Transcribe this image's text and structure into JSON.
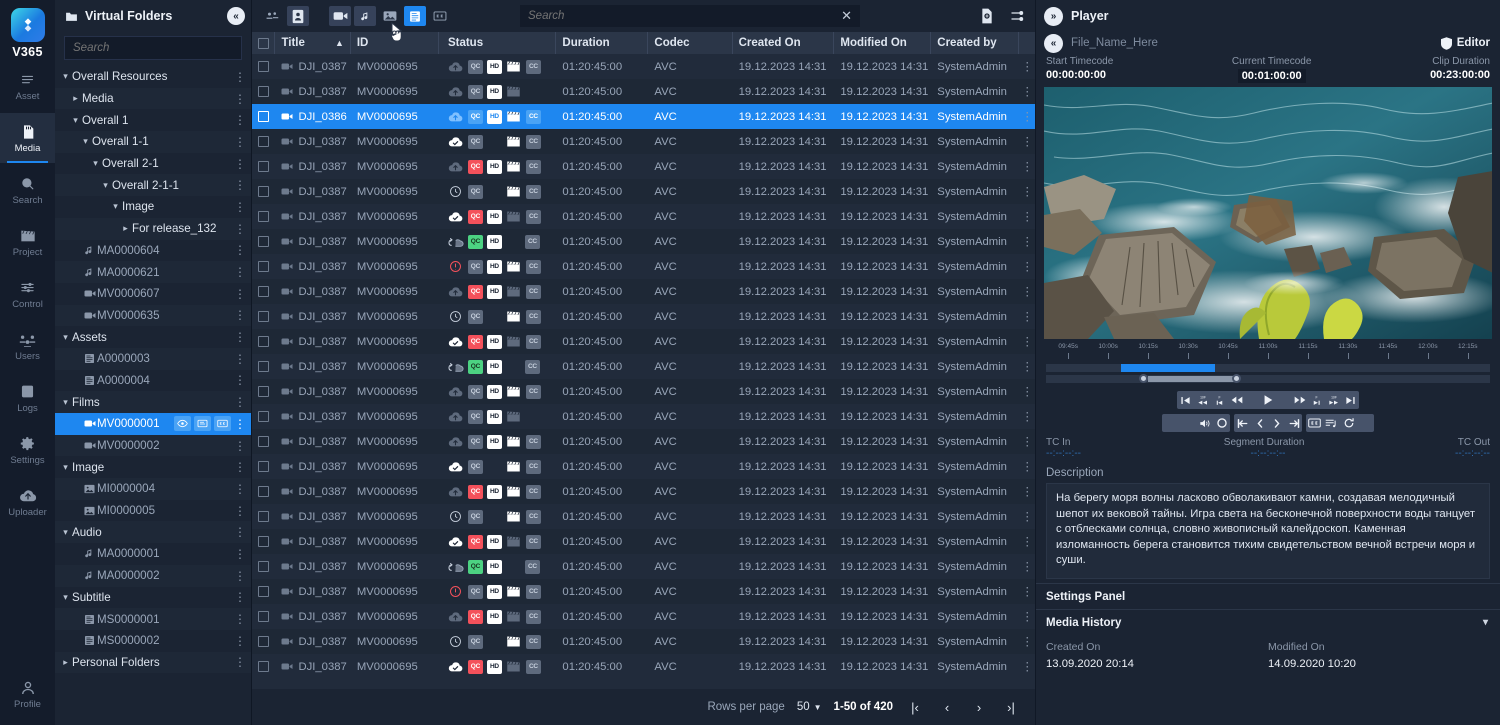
{
  "rail": {
    "brand": "V365",
    "items": [
      {
        "label": "Asset",
        "icon": "list-icon",
        "active": false
      },
      {
        "label": "Media",
        "icon": "sdcard-icon",
        "active": true
      },
      {
        "label": "Search",
        "icon": "search-icon",
        "active": false
      },
      {
        "label": "Project",
        "icon": "clapperboard-icon",
        "active": false
      },
      {
        "label": "Control",
        "icon": "sliders-icon",
        "active": false
      },
      {
        "label": "Users",
        "icon": "users-icon",
        "active": false
      },
      {
        "label": "Logs",
        "icon": "document-icon",
        "active": false
      },
      {
        "label": "Settings",
        "icon": "gear-icon",
        "active": false
      },
      {
        "label": "Uploader",
        "icon": "cloud-upload-icon",
        "active": false
      }
    ],
    "profile": {
      "label": "Profile",
      "icon": "person-icon"
    }
  },
  "tree": {
    "title": "Virtual Folders",
    "title_icon": "folder-icon",
    "collapse_icon": "collapse-left-icon",
    "search_placeholder": "Search",
    "nodes": [
      {
        "label": "Overall Resources",
        "indent": 0,
        "caret": "down",
        "icon": "",
        "group": true
      },
      {
        "label": "Media",
        "indent": 1,
        "caret": "right",
        "icon": "",
        "group": true
      },
      {
        "label": "Overall 1",
        "indent": 1,
        "caret": "down",
        "icon": "",
        "group": true
      },
      {
        "label": "Overall 1-1",
        "indent": 2,
        "caret": "down",
        "icon": "",
        "group": true
      },
      {
        "label": "Overall 2-1",
        "indent": 3,
        "caret": "down",
        "icon": "",
        "group": true
      },
      {
        "label": "Overall 2-1-1",
        "indent": 4,
        "caret": "down",
        "icon": "",
        "group": true
      },
      {
        "label": "Image",
        "indent": 5,
        "caret": "down",
        "icon": "",
        "group": true
      },
      {
        "label": "For release_132",
        "indent": 6,
        "caret": "right",
        "icon": "",
        "group": true
      },
      {
        "label": "MA0000604",
        "indent": 1,
        "caret": "",
        "icon": "audio-icon",
        "group": false
      },
      {
        "label": "MA0000621",
        "indent": 1,
        "caret": "",
        "icon": "audio-icon",
        "group": false
      },
      {
        "label": "MV0000607",
        "indent": 1,
        "caret": "",
        "icon": "video-icon",
        "group": false
      },
      {
        "label": "MV0000635",
        "indent": 1,
        "caret": "",
        "icon": "video-icon",
        "group": false
      },
      {
        "label": "Assets",
        "indent": 0,
        "caret": "down",
        "icon": "",
        "group": true
      },
      {
        "label": "A0000003",
        "indent": 1,
        "caret": "",
        "icon": "subtitle-icon",
        "group": false
      },
      {
        "label": "A0000004",
        "indent": 1,
        "caret": "",
        "icon": "subtitle-icon",
        "group": false
      },
      {
        "label": "Films",
        "indent": 0,
        "caret": "down",
        "icon": "",
        "group": true
      },
      {
        "label": "MV0000001",
        "indent": 1,
        "caret": "",
        "icon": "video-icon",
        "group": false,
        "selected": true,
        "actions": [
          "eye-icon",
          "monitor-icon",
          "cc-icon"
        ]
      },
      {
        "label": "MV0000002",
        "indent": 1,
        "caret": "",
        "icon": "video-icon",
        "group": false
      },
      {
        "label": "Image",
        "indent": 0,
        "caret": "down",
        "icon": "",
        "group": true
      },
      {
        "label": "MI0000004",
        "indent": 1,
        "caret": "",
        "icon": "image-icon",
        "group": false
      },
      {
        "label": "MI0000005",
        "indent": 1,
        "caret": "",
        "icon": "image-icon",
        "group": false
      },
      {
        "label": "Audio",
        "indent": 0,
        "caret": "down",
        "icon": "",
        "group": true
      },
      {
        "label": "MA0000001",
        "indent": 1,
        "caret": "",
        "icon": "audio-icon",
        "group": false
      },
      {
        "label": "MA0000002",
        "indent": 1,
        "caret": "",
        "icon": "audio-icon",
        "group": false
      },
      {
        "label": "Subtitle",
        "indent": 0,
        "caret": "down",
        "icon": "",
        "group": true
      },
      {
        "label": "MS0000001",
        "indent": 1,
        "caret": "",
        "icon": "subtitle-icon",
        "group": false
      },
      {
        "label": "MS0000002",
        "indent": 1,
        "caret": "",
        "icon": "subtitle-icon",
        "group": false
      },
      {
        "label": "Personal Folders",
        "indent": 0,
        "caret": "right",
        "icon": "",
        "group": true
      }
    ]
  },
  "toolbar": {
    "left_group": [
      {
        "name": "users-filter-icon",
        "state": "off"
      },
      {
        "name": "person-card-filter-icon",
        "state": "soft"
      }
    ],
    "type_group": [
      {
        "name": "video-filter-icon",
        "state": "soft"
      },
      {
        "name": "audio-filter-icon",
        "state": "soft"
      },
      {
        "name": "image-filter-icon",
        "state": "off"
      },
      {
        "name": "subtitle-filter-icon",
        "state": "on"
      },
      {
        "name": "cc-filter-icon",
        "state": "off"
      }
    ],
    "search_placeholder": "Search",
    "search_value": "",
    "clear_label": "✕",
    "right_group": [
      {
        "name": "export-doc-icon"
      },
      {
        "name": "columns-settings-icon"
      }
    ]
  },
  "table": {
    "columns": [
      {
        "key": "title",
        "label": "Title",
        "sort": "asc"
      },
      {
        "key": "id",
        "label": "ID"
      },
      {
        "key": "status",
        "label": "Status"
      },
      {
        "key": "duration",
        "label": "Duration"
      },
      {
        "key": "codec",
        "label": "Codec"
      },
      {
        "key": "created_on",
        "label": "Created On"
      },
      {
        "key": "modified_on",
        "label": "Modified On"
      },
      {
        "key": "created_by",
        "label": "Created by"
      }
    ],
    "common": {
      "title": "DJI_0387",
      "id": "MV0000695",
      "duration": "01:20:45:00",
      "codec": "AVC",
      "created_on": "19.12.2023 14:31",
      "modified_on": "19.12.2023 14:31",
      "created_by": "SystemAdmin"
    },
    "selected_row": {
      "index": 2,
      "title": "DJI_0386"
    },
    "status_variants": [
      {
        "cloud": "upload-grey",
        "qc": "grey",
        "hd": "white",
        "clap": "white",
        "cc": "grey"
      },
      {
        "cloud": "upload-grey",
        "qc": "grey",
        "hd": "white",
        "clap": "grey",
        "cc": "none"
      },
      {
        "cloud": "upload-grey",
        "qc": "grey",
        "hd": "white",
        "clap": "white",
        "cc": "grey"
      },
      {
        "cloud": "check-white",
        "qc": "grey",
        "hd": "none",
        "clap": "white",
        "cc": "grey"
      },
      {
        "cloud": "upload-grey",
        "qc": "red",
        "hd": "white",
        "clap": "white",
        "cc": "grey"
      },
      {
        "cloud": "clock-grey",
        "qc": "grey",
        "hd": "none",
        "clap": "white",
        "cc": "grey"
      },
      {
        "cloud": "check-white",
        "qc": "red",
        "hd": "white",
        "clap": "grey",
        "cc": "grey"
      },
      {
        "cloud": "transfer-grey",
        "qc": "green",
        "hd": "white",
        "clap": "none",
        "cc": "grey"
      },
      {
        "cloud": "error-red",
        "qc": "grey",
        "hd": "white",
        "clap": "white",
        "cc": "grey"
      },
      {
        "cloud": "upload-grey",
        "qc": "red",
        "hd": "white",
        "clap": "grey",
        "cc": "grey"
      },
      {
        "cloud": "clock-grey",
        "qc": "grey",
        "hd": "none",
        "clap": "white",
        "cc": "grey"
      },
      {
        "cloud": "check-white",
        "qc": "red",
        "hd": "white",
        "clap": "grey",
        "cc": "grey"
      },
      {
        "cloud": "transfer-grey",
        "qc": "green",
        "hd": "white",
        "clap": "none",
        "cc": "grey"
      }
    ],
    "row_count": 25
  },
  "footer": {
    "rows_per_page_label": "Rows per page",
    "rows_per_page_value": "50",
    "range_label": "1-50 of 420",
    "first_label": "|‹",
    "prev_label": "‹",
    "next_label": "›",
    "last_label": "›|"
  },
  "player": {
    "title": "Player",
    "expand_icon": "expand-right-icon",
    "collapse_icon": "collapse-left-icon",
    "file_name": "File_Name_Here",
    "editor_label": "Editor",
    "editor_icon": "shield-icon",
    "timecodes": {
      "start_label": "Start Timecode",
      "start_value": "00:00:00:00",
      "current_label": "Current Timecode",
      "current_value": "00:01:00:00",
      "duration_label": "Clip Duration",
      "duration_value": "00:23:00:00"
    },
    "ruler_ticks": [
      "09:45s",
      "10:00s",
      "10:15s",
      "10:30s",
      "10:45s",
      "11:00s",
      "11:15s",
      "11:30s",
      "11:45s",
      "12:00s",
      "12:15s"
    ],
    "transport_primary": [
      "go-to-start-icon",
      "skip-back-10-icon",
      "step-back-icon",
      "rewind-icon",
      "play-icon",
      "fast-forward-icon",
      "step-forward-icon",
      "skip-forward-10-icon",
      "go-to-end-icon"
    ],
    "transport_secondary": [
      "volume-icon",
      "record-icon",
      "mark-in-edge-icon",
      "mark-in-icon",
      "mark-out-icon",
      "mark-out-edge-icon",
      "cc-toggle-icon",
      "playlist-icon",
      "loop-icon"
    ],
    "tc_in_label": "TC In",
    "tc_in_value": "--:--:--:--",
    "segment_label": "Segment Duration",
    "segment_value": "--:--:--:--",
    "tc_out_label": "TC Out",
    "tc_out_value": "--:--:--:--",
    "description_label": "Description",
    "description_text": "На берегу моря волны ласково обволакивают камни, создавая мелодичный шепот их вековой тайны. Игра света на бесконечной поверхности воды танцует с отблесками солнца, словно живописный калейдоскоп. Каменная изломанность берега становится тихим свидетельством вечной встречи моря и суши.",
    "settings_panel_label": "Settings Panel",
    "media_history_label": "Media History",
    "media_history_chevron": "chevron-down-icon",
    "history": {
      "created_label": "Created On",
      "created_value": "13.09.2020 20:14",
      "modified_label": "Modified On",
      "modified_value": "14.09.2020 10:20"
    }
  },
  "colors": {
    "accent": "#1e87f0",
    "danger": "#f4515b",
    "ok": "#4cd282",
    "panel": "#1b2433"
  }
}
